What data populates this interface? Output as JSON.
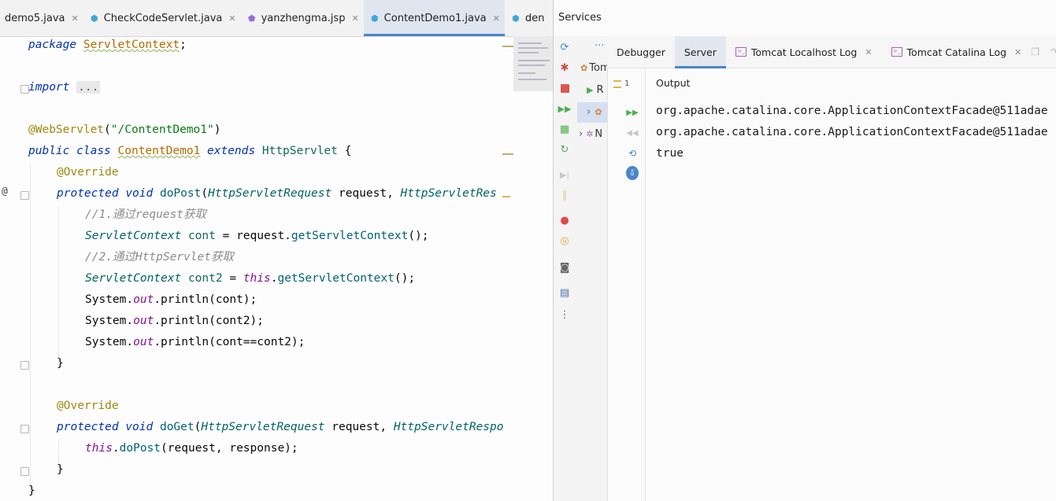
{
  "editor": {
    "tabs": [
      {
        "label": "demo5.java",
        "icon": "java-file-icon",
        "active": false
      },
      {
        "label": "CheckCodeServlet.java",
        "icon": "java-class-icon",
        "active": false
      },
      {
        "label": "yanzhengma.jsp",
        "icon": "jsp-file-icon",
        "active": false
      },
      {
        "label": "ContentDemo1.java",
        "icon": "java-class-icon",
        "active": true
      },
      {
        "label": "den",
        "icon": "java-class-icon",
        "active": false
      }
    ],
    "tabs_overflow": "3",
    "code": {
      "l1_kw": "package",
      "l1_pkg": "ServletContext",
      "l1_end": ";",
      "l2_kw": "import",
      "l2_fold": "...",
      "l3_ann": "@WebServlet",
      "l3_open": "(",
      "l3_str": "\"/ContentDemo1\"",
      "l3_close": ")",
      "l4_kw1": "public",
      "l4_kw2": "class",
      "l4_name": "ContentDemo1",
      "l4_kw3": "extends",
      "l4_super": "HttpServlet",
      "l4_brace": "{",
      "l5_ann": "@Override",
      "l6_kw1": "protected",
      "l6_kw2": "void",
      "l6_meth": "doPost",
      "l6_open": "(",
      "l6_t1": "HttpServletRequest",
      "l6_p1": " request, ",
      "l6_t2": "HttpServletRes",
      "l7_com": "//1.通过request获取",
      "l8_type": "ServletContext",
      "l8_var": "cont",
      "l8_eq": " = request.",
      "l8_meth": "getServletContext",
      "l8_end": "();",
      "l9_com": "//2.通过HttpServlet获取",
      "l10_type": "ServletContext",
      "l10_var": "cont2",
      "l10_eq": " = ",
      "l10_this": "this",
      "l10_dot": ".",
      "l10_meth": "getServletContext",
      "l10_end": "();",
      "l11_sys": "System.",
      "l11_out": "out",
      "l11_rest": ".println(cont);",
      "l12_sys": "System.",
      "l12_out": "out",
      "l12_rest": ".println(cont2);",
      "l13_sys": "System.",
      "l13_out": "out",
      "l13_rest": ".println(cont==cont2);",
      "l14": "}",
      "l15_ann": "@Override",
      "l16_kw1": "protected",
      "l16_kw2": "void",
      "l16_meth": "doGet",
      "l16_open": "(",
      "l16_t1": "HttpServletRequest",
      "l16_p1": " request, ",
      "l16_t2": "HttpServletRespo",
      "l17_this": "this",
      "l17_dot": ".",
      "l17_meth": "doPost",
      "l17_rest": "(request, response);",
      "l18": "}",
      "l19": "}"
    },
    "gutter_at": "@"
  },
  "services": {
    "title": "Services",
    "tree": {
      "dots": "···",
      "row1": "Tom",
      "row2": "R",
      "row3": "",
      "row4": "N"
    },
    "tabs": [
      {
        "label": "Debugger",
        "active": false,
        "icon": ""
      },
      {
        "label": "Server",
        "active": true,
        "icon": ""
      },
      {
        "label": "Tomcat Localhost Log",
        "active": false,
        "icon": "terminal-icon"
      },
      {
        "label": "Tomcat Catalina Log",
        "active": false,
        "icon": "terminal-icon"
      }
    ],
    "output_count": "1",
    "output_title": "Output",
    "console_lines": [
      "org.apache.catalina.core.ApplicationContextFacade@511adae",
      "org.apache.catalina.core.ApplicationContextFacade@511adae",
      "true"
    ]
  },
  "colors": {
    "accent": "#4a86c8",
    "run_green": "#4caf50",
    "stop_red": "#e05555"
  }
}
